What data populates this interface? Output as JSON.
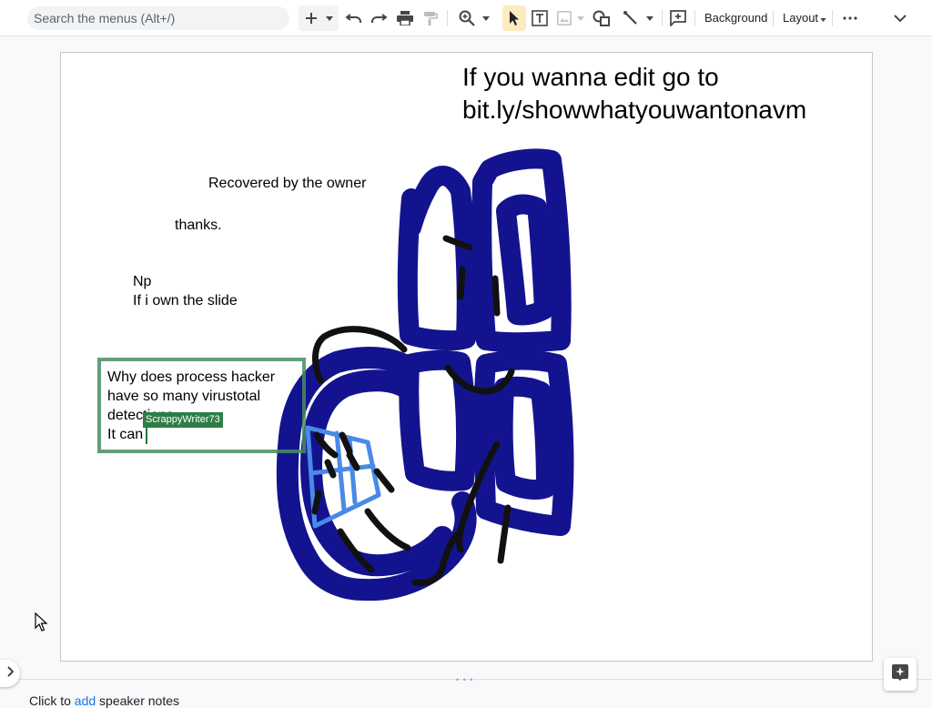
{
  "toolbar": {
    "search_placeholder": "Search the menus (Alt+/)",
    "background_label": "Background",
    "layout_label": "Layout"
  },
  "slide": {
    "title_line1": "If you wanna edit go to",
    "title_line2": "bit.ly/showwhatyouwantonavm",
    "note1": "Recovered by the owner",
    "note2": "thanks.",
    "note3_line1": "Np",
    "note3_line2": "If i own the slide",
    "textbox_line1": "Why does process hacker",
    "textbox_line2": "have so many virustotal",
    "textbox_line3": "detections",
    "textbox_line4": "It can",
    "collaborator_name": "ScrappyWriter73"
  },
  "speaker_notes": {
    "prefix": "Click to ",
    "link": "add",
    "suffix": " speaker notes"
  },
  "colors": {
    "selection_border": "#468e62",
    "collaborator": "#2e7d46",
    "scribble_navy": "#14138f",
    "scribble_black": "#111111",
    "scribble_blue": "#4a89e8"
  }
}
